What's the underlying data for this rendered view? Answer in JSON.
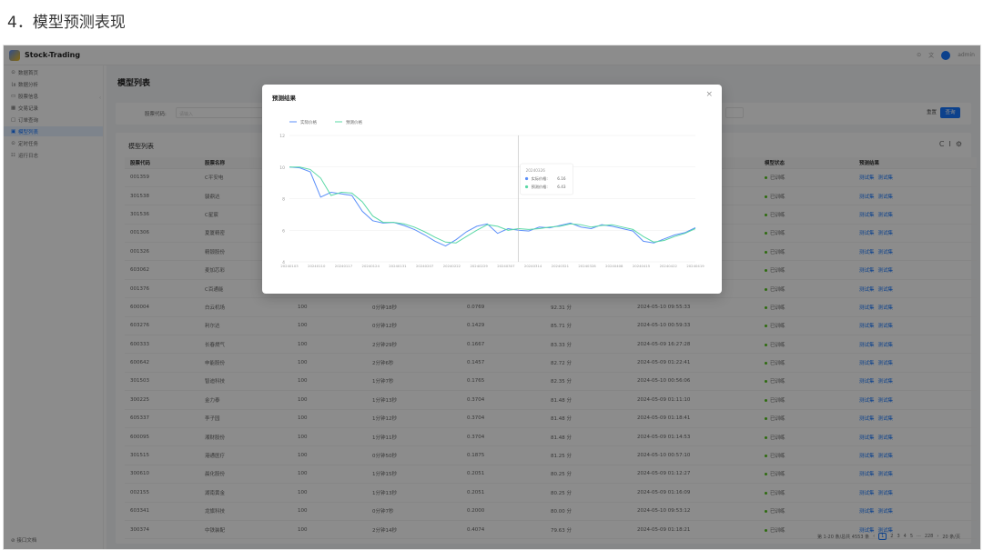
{
  "heading": "4．模型预测表现",
  "app": {
    "brand": "Stock-Trading",
    "user": "admin"
  },
  "sidebar": {
    "items": [
      {
        "icon": "⊙",
        "label": "数据首页"
      },
      {
        "icon": "㏑",
        "label": "数据分析"
      },
      {
        "icon": "▭",
        "label": "股票信息"
      },
      {
        "icon": "▦",
        "label": "交易记录"
      },
      {
        "icon": "▢",
        "label": "订单查询"
      },
      {
        "icon": "▣",
        "label": "模型列表",
        "active": true
      },
      {
        "icon": "⊙",
        "label": "定时任务"
      },
      {
        "icon": "☷",
        "label": "运行日志"
      }
    ],
    "footer": "接口文档"
  },
  "page": {
    "title": "模型列表",
    "filter_label": "股票代码:",
    "filter_placeholder": "请输入",
    "reset_label": "重置",
    "query_label": "查询",
    "table_title": "模型列表",
    "tools": [
      "C",
      "I",
      "⚙"
    ]
  },
  "table": {
    "columns": [
      "股票代码",
      "股票名称",
      "",
      "",
      "",
      "",
      "",
      "模型状态",
      "预测结果"
    ],
    "rows": [
      [
        "001359",
        "C平安电",
        "",
        "",
        "",
        "",
        "",
        "已训练",
        "测试集 测试集"
      ],
      [
        "301538",
        "骏鼎达",
        "",
        "",
        "",
        "",
        "",
        "已训练",
        "测试集 测试集"
      ],
      [
        "301536",
        "C星宸",
        "",
        "",
        "",
        "",
        "",
        "已训练",
        "测试集 测试集"
      ],
      [
        "001306",
        "夏厦精密",
        "",
        "",
        "",
        "",
        "",
        "已训练",
        "测试集 测试集"
      ],
      [
        "001326",
        "精锻股份",
        "",
        "",
        "",
        "",
        "",
        "已训练",
        "测试集 测试集"
      ],
      [
        "603062",
        "麦加芯彩",
        "",
        "",
        "",
        "",
        "",
        "已训练",
        "测试集 测试集"
      ],
      [
        "001376",
        "C百通能",
        "",
        "",
        "",
        "",
        "",
        "已训练",
        "测试集 测试集"
      ],
      [
        "600004",
        "白云机场",
        "100",
        "0分钟18秒",
        "0.0769",
        "92.31 分",
        "2024-05-10 09:55:33",
        "已训练",
        "测试集 测试集"
      ],
      [
        "603276",
        "利尔达",
        "100",
        "0分钟12秒",
        "0.1429",
        "85.71 分",
        "2024-05-10 00:59:33",
        "已训练",
        "测试集 测试集"
      ],
      [
        "600333",
        "长春燃气",
        "100",
        "2分钟29秒",
        "0.1667",
        "83.33 分",
        "2024-05-09 16:27:28",
        "已训练",
        "测试集 测试集"
      ],
      [
        "600642",
        "申能股份",
        "100",
        "2分钟6秒",
        "0.1457",
        "82.72 分",
        "2024-05-09 01:22:41",
        "已训练",
        "测试集 测试集"
      ],
      [
        "301503",
        "智迪科技",
        "100",
        "1分钟7秒",
        "0.1765",
        "82.35 分",
        "2024-05-10 00:56:06",
        "已训练",
        "测试集 测试集"
      ],
      [
        "300225",
        "金力泰",
        "100",
        "1分钟13秒",
        "0.3704",
        "81.48 分",
        "2024-05-09 01:11:10",
        "已训练",
        "测试集 测试集"
      ],
      [
        "605337",
        "李子园",
        "100",
        "1分钟12秒",
        "0.3704",
        "81.48 分",
        "2024-05-09 01:18:41",
        "已训练",
        "测试集 测试集"
      ],
      [
        "600095",
        "湘财股份",
        "100",
        "1分钟11秒",
        "0.3704",
        "81.48 分",
        "2024-05-09 01:14:53",
        "已训练",
        "测试集 测试集"
      ],
      [
        "301515",
        "港通医疗",
        "100",
        "0分钟50秒",
        "0.1875",
        "81.25 分",
        "2024-05-10 00:57:10",
        "已训练",
        "测试集 测试集"
      ],
      [
        "300610",
        "晨化股份",
        "100",
        "1分钟15秒",
        "0.2051",
        "80.25 分",
        "2024-05-09 01:12:27",
        "已训练",
        "测试集 测试集"
      ],
      [
        "002155",
        "湖南黄金",
        "100",
        "1分钟13秒",
        "0.2051",
        "80.25 分",
        "2024-05-09 01:16:09",
        "已训练",
        "测试集 测试集"
      ],
      [
        "603341",
        "龙旗科技",
        "100",
        "0分钟7秒",
        "0.2000",
        "80.00 分",
        "2024-05-10 09:53:12",
        "已训练",
        "测试集 测试集"
      ],
      [
        "300374",
        "中铁装配",
        "100",
        "2分钟14秒",
        "0.4074",
        "79.63 分",
        "2024-05-09 01:18:21",
        "已训练",
        "测试集 测试集"
      ]
    ]
  },
  "pager": {
    "summary": "第 1-20 条/总共 4553 条",
    "pages": [
      "1",
      "2",
      "3",
      "4",
      "5",
      "···",
      "228"
    ],
    "current": "1",
    "size": "20 条/页"
  },
  "modal": {
    "title": "预测结果",
    "close": "×"
  },
  "chart_data": {
    "type": "line",
    "title": "",
    "series": [
      {
        "name": "实际价格",
        "color": "#5b8ff9",
        "values": [
          10.0,
          9.95,
          9.7,
          8.1,
          8.4,
          8.3,
          8.2,
          7.2,
          6.6,
          6.45,
          6.5,
          6.3,
          6.05,
          5.7,
          5.3,
          5.0,
          5.4,
          5.9,
          6.25,
          6.4,
          5.8,
          6.1,
          6.0,
          5.95,
          6.2,
          6.15,
          6.3,
          6.45,
          6.2,
          6.1,
          6.35,
          6.25,
          6.1,
          5.95,
          5.3,
          5.2,
          5.45,
          5.7,
          5.85,
          6.16
        ]
      },
      {
        "name": "预测价格",
        "color": "#5ad8a6",
        "values": [
          10.0,
          10.0,
          9.85,
          9.3,
          8.2,
          8.4,
          8.35,
          7.8,
          6.9,
          6.5,
          6.5,
          6.4,
          6.2,
          5.9,
          5.55,
          5.25,
          5.2,
          5.6,
          6.0,
          6.35,
          6.25,
          6.0,
          6.1,
          6.05,
          6.1,
          6.2,
          6.25,
          6.4,
          6.35,
          6.2,
          6.3,
          6.35,
          6.2,
          6.05,
          5.6,
          5.25,
          5.35,
          5.6,
          5.8,
          6.1
        ]
      },
      {
        "categories_note": ""
      }
    ],
    "x_ticks": [
      "20240103",
      "20240110",
      "20240117",
      "20240124",
      "20240131",
      "20240207",
      "20240222",
      "20240229",
      "20240307",
      "20240314",
      "20240321",
      "20240328",
      "20240408",
      "20240415",
      "20240422",
      "20240419"
    ],
    "y_ticks": [
      4,
      6,
      8,
      10,
      12
    ],
    "ylim": [
      4,
      12
    ],
    "legend_position": "top-left",
    "tooltip": {
      "date": "20240326",
      "rows": [
        {
          "label": "实际价格:",
          "value": "6.16"
        },
        {
          "label": "预测价格:",
          "value": "6.43"
        }
      ]
    }
  }
}
